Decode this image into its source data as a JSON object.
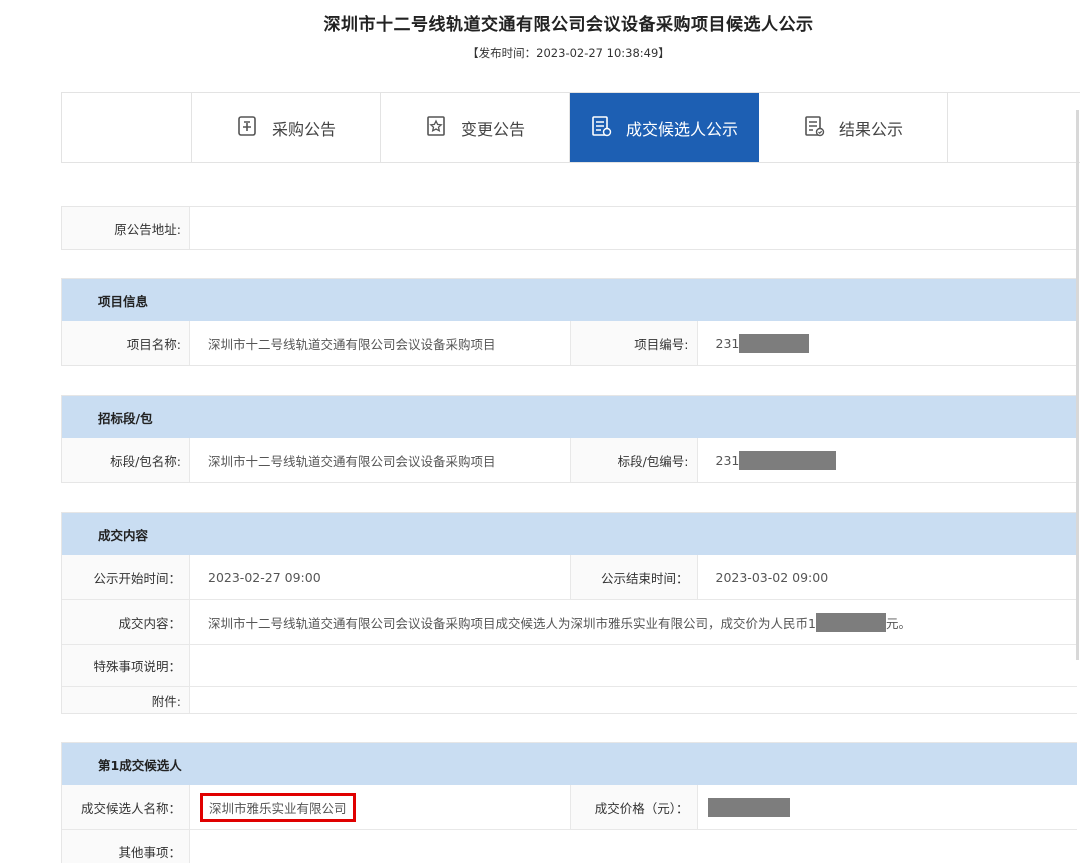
{
  "page": {
    "title": "深圳市十二号线轨道交通有限公司会议设备采购项目候选人公示",
    "publish_time": "【发布时间：2023-02-27 10:38:49】"
  },
  "tabs": [
    {
      "label": "采购公告",
      "icon": "document-upload-icon"
    },
    {
      "label": "变更公告",
      "icon": "star-document-icon"
    },
    {
      "label": "成交候选人公示",
      "icon": "document-list-icon",
      "active": true
    },
    {
      "label": "结果公示",
      "icon": "document-check-icon"
    }
  ],
  "original": {
    "label": "原公告地址:",
    "value": ""
  },
  "project_info": {
    "heading": "项目信息",
    "name_label": "项目名称:",
    "name_value": "深圳市十二号线轨道交通有限公司会议设备采购项目",
    "code_label": "项目编号:",
    "code_value": "231"
  },
  "tender_section": {
    "heading": "招标段/包",
    "name_label": "标段/包名称:",
    "name_value": "深圳市十二号线轨道交通有限公司会议设备采购项目",
    "code_label": "标段/包编号:",
    "code_value": "231"
  },
  "deal_content": {
    "heading": "成交内容",
    "start_label": "公示开始时间：",
    "start_value": "2023-02-27 09:00",
    "end_label": "公示结束时间：",
    "end_value": "2023-03-02 09:00",
    "content_label": "成交内容：",
    "content_value_a": "深圳市十二号线轨道交通有限公司会议设备采购项目成交候选人为深圳市雅乐实业有限公司，成交价为人民币1",
    "content_value_b": "元。",
    "special_label": "特殊事项说明：",
    "special_value": "",
    "attach_label": "附件:",
    "attach_value": ""
  },
  "candidate": {
    "heading": "第1成交候选人",
    "name_label": "成交候选人名称：",
    "name_value": "深圳市雅乐实业有限公司",
    "price_label": "成交价格（元）：",
    "price_value": "",
    "other_label": "其他事项：",
    "other_value": ""
  }
}
